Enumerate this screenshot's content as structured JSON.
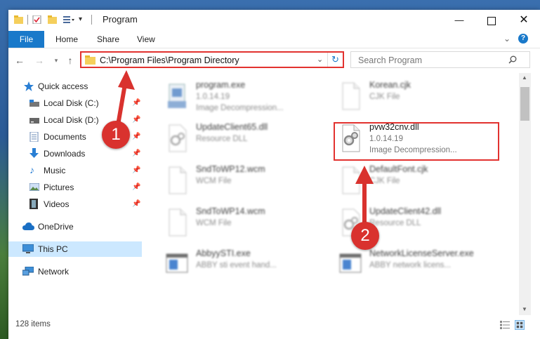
{
  "window": {
    "title": "Program"
  },
  "ribbon": {
    "file": "File",
    "tabs": [
      "Home",
      "Share",
      "View"
    ]
  },
  "address": {
    "path": "C:\\Program Files\\Program Directory"
  },
  "search": {
    "placeholder": "Search Program"
  },
  "sidebar": {
    "items": [
      {
        "label": "Quick access",
        "icon": "star-icon"
      },
      {
        "label": "Local Disk (C:)",
        "icon": "drive-icon"
      },
      {
        "label": "Local Disk (D:)",
        "icon": "drive-icon"
      },
      {
        "label": "Documents",
        "icon": "documents-icon"
      },
      {
        "label": "Downloads",
        "icon": "downloads-icon"
      },
      {
        "label": "Music",
        "icon": "music-icon"
      },
      {
        "label": "Pictures",
        "icon": "pictures-icon"
      },
      {
        "label": "Videos",
        "icon": "videos-icon"
      },
      {
        "label": "OneDrive",
        "icon": "cloud-icon"
      },
      {
        "label": "This PC",
        "icon": "computer-icon"
      },
      {
        "label": "Network",
        "icon": "network-icon"
      }
    ]
  },
  "files": [
    {
      "name": "program.exe",
      "line1": "1.0.14.19",
      "line2": "Image Decompression..."
    },
    {
      "name": "Korean.cjk",
      "line1": "CJK File",
      "line2": ""
    },
    {
      "name": "UpdateClient65.dll",
      "line1": "Resource DLL",
      "line2": ""
    },
    {
      "name": "pvw32cnv.dll",
      "line1": "1.0.14.19",
      "line2": "Image Decompression..."
    },
    {
      "name": "SndToWP12.wcm",
      "line1": "WCM File",
      "line2": ""
    },
    {
      "name": "DefaultFont.cjk",
      "line1": "CJK File",
      "line2": ""
    },
    {
      "name": "SndToWP14.wcm",
      "line1": "WCM File",
      "line2": ""
    },
    {
      "name": "UpdateClient42.dll",
      "line1": "Resource DLL",
      "line2": ""
    },
    {
      "name": "AbbyySTI.exe",
      "line1": "ABBY sti event hand...",
      "line2": ""
    },
    {
      "name": "NetworkLicenseServer.exe",
      "line1": "ABBY network licens...",
      "line2": ""
    }
  ],
  "status": {
    "count": "128 items"
  },
  "callouts": {
    "one": "1",
    "two": "2"
  },
  "colors": {
    "accent": "#1979ca",
    "highlight": "#e2322f",
    "badge": "#d9322e"
  }
}
